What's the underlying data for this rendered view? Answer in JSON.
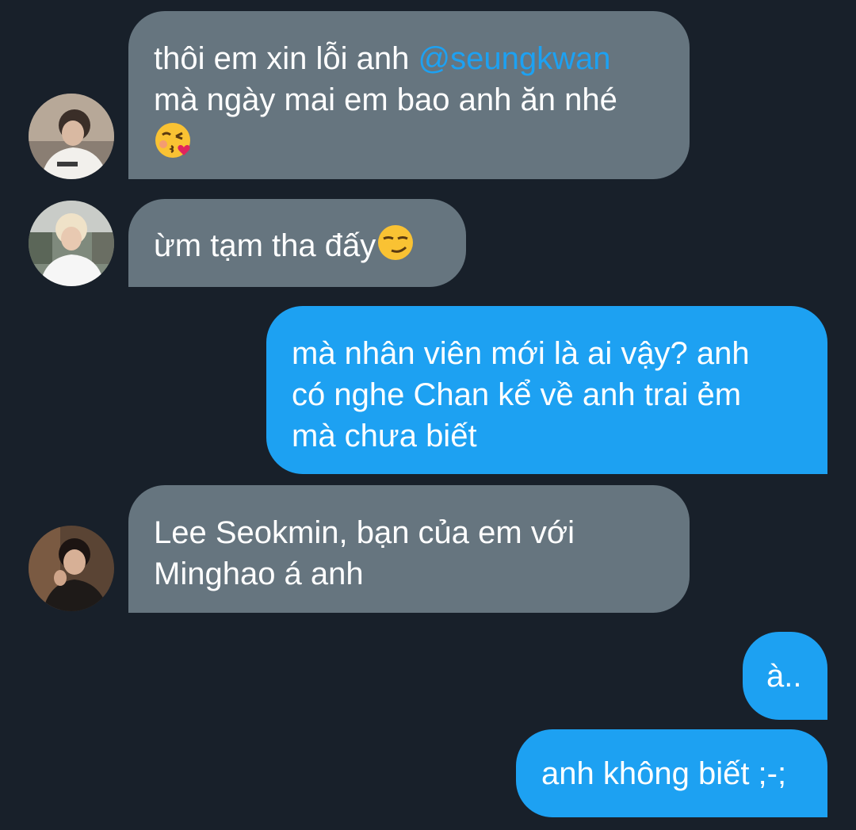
{
  "messages": [
    {
      "direction": "incoming",
      "lines": [
        "thôi em xin lỗi anh ",
        "mà ngày mai em bao anh ăn nhé"
      ],
      "mention": "@seungkwan",
      "emoji": "kissing-face-with-heart"
    },
    {
      "direction": "incoming",
      "text": "ừm tạm tha đấy",
      "emoji": "smirking-face"
    },
    {
      "direction": "outgoing",
      "lines": [
        "mà nhân viên mới là ai vậy? anh",
        "có nghe Chan kể về anh trai ẻm",
        "mà chưa biết"
      ]
    },
    {
      "direction": "incoming",
      "lines": [
        "Lee Seokmin, bạn của em với",
        "Minghao á anh"
      ]
    },
    {
      "direction": "outgoing",
      "text": "à.."
    },
    {
      "direction": "outgoing",
      "text": "anh không biết ;-;"
    }
  ],
  "colors": {
    "background": "#18202a",
    "incoming_bubble": "#66757f",
    "outgoing_bubble": "#1da1f2",
    "mention": "#1da1f2",
    "text": "#ffffff"
  }
}
